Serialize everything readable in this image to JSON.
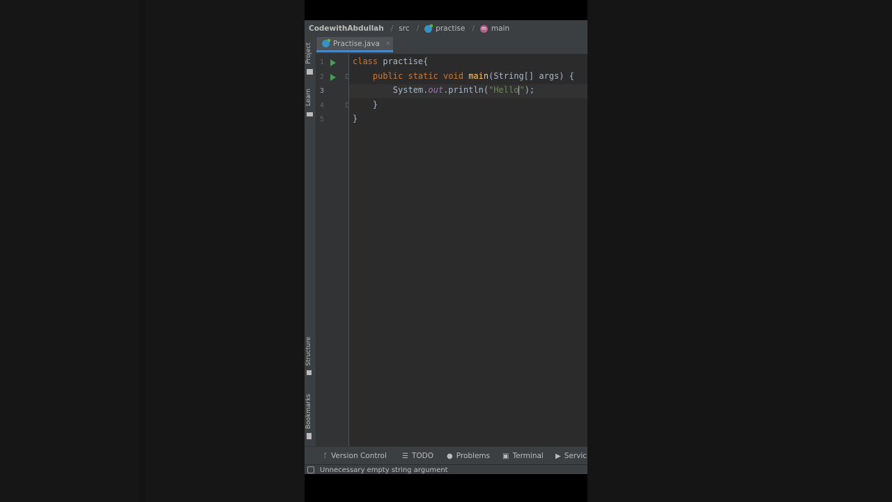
{
  "navbar": {
    "project": "CodewithAbdullah",
    "crumbs": [
      "src",
      "practise",
      "main"
    ],
    "crumb_icons": [
      "folder",
      "class-icon",
      "method-icon"
    ]
  },
  "left_toolbar": {
    "project_label": "Project",
    "learn_label": "Learn",
    "structure_label": "Structure",
    "bookmarks_label": "Bookmarks"
  },
  "tab": {
    "label": "Practise.java",
    "close": "×"
  },
  "gutter": {
    "line_numbers": [
      "1",
      "2",
      "3",
      "4",
      "5"
    ],
    "current_line": "3"
  },
  "code": {
    "line1": {
      "kw": "class",
      "rest": " practise{"
    },
    "line2": {
      "indent": "    ",
      "kw": "public static void",
      "fn": "main",
      "rest": "(String[] args) {"
    },
    "line3": {
      "indent": "        ",
      "cls": "System.",
      "fld": "out",
      "call": ".println(",
      "str": "\"Hello",
      "str_end": "\"",
      "end": ");"
    },
    "line4": "    }",
    "line5": "}"
  },
  "tool_windows": {
    "version_control": "Version Control",
    "todo": "TODO",
    "problems": "Problems",
    "terminal": "Terminal",
    "services": "Servic"
  },
  "status": {
    "message": "Unnecessary empty string argument"
  },
  "colors": {
    "keyword": "#cc7832",
    "function": "#ffc66d",
    "field": "#9876aa",
    "string": "#6a8759",
    "run_icon": "#499c54",
    "tab_underline": "#4a88c7"
  }
}
